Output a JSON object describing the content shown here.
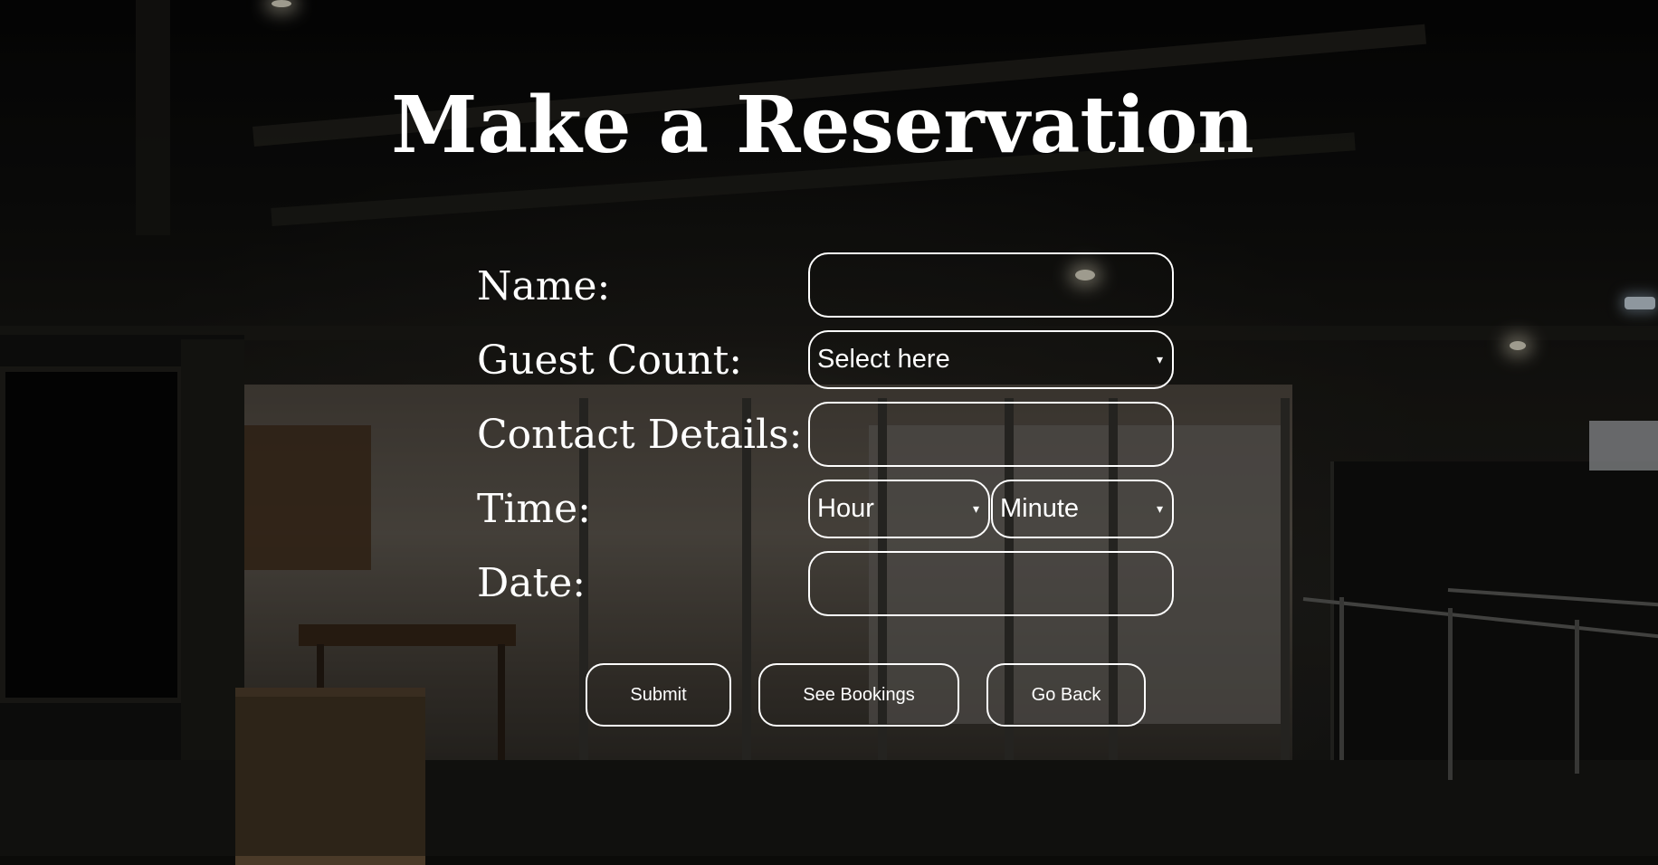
{
  "page": {
    "title": "Make a Reservation"
  },
  "form": {
    "name": {
      "label": "Name:",
      "value": ""
    },
    "guest_count": {
      "label": "Guest Count:",
      "selected": "Select here"
    },
    "contact": {
      "label": "Contact Details:",
      "value": ""
    },
    "time": {
      "label": "Time:",
      "hour_selected": "Hour",
      "minute_selected": "Minute"
    },
    "date": {
      "label": "Date:",
      "value": ""
    }
  },
  "buttons": {
    "submit": "Submit",
    "see_bookings": "See Bookings",
    "go_back": "Go Back"
  },
  "icons": {
    "dropdown_arrow": "▾"
  },
  "colors": {
    "text": "#ffffff",
    "border": "#ffffff"
  }
}
